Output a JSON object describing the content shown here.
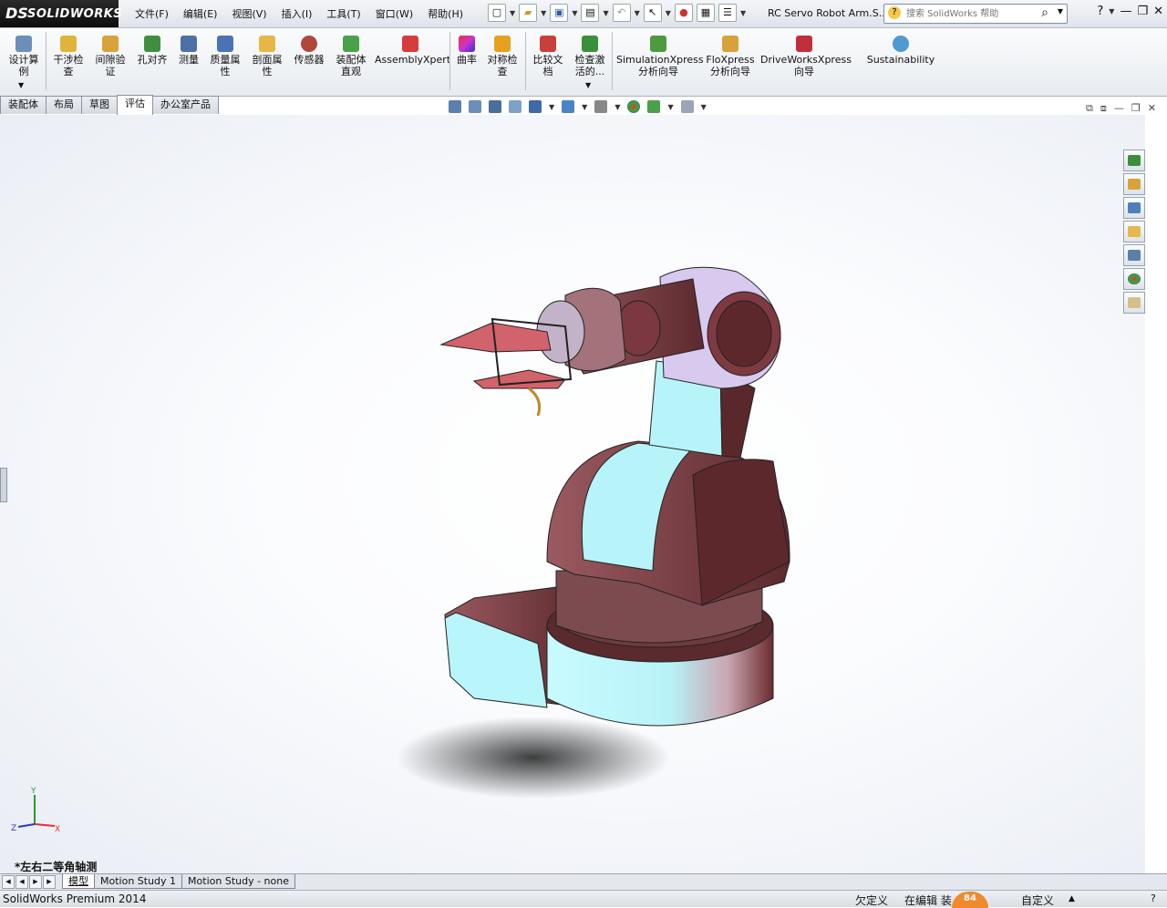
{
  "app": {
    "logo_mark": "DS",
    "logo_text": "SOLIDWORKS",
    "doc_title": "RC Servo Robot Arm.S...",
    "search_placeholder": "搜索 SolidWorks 帮助",
    "help_label": "?"
  },
  "menus": [
    "文件(F)",
    "编辑(E)",
    "视图(V)",
    "插入(I)",
    "工具(T)",
    "窗口(W)",
    "帮助(H)"
  ],
  "ribbon": {
    "tools": [
      {
        "label": "设计算\n例",
        "icon": "design-study-icon",
        "color": "#6b8fb8"
      },
      {
        "label": "干涉检\n查",
        "icon": "interference-check-icon",
        "color": "#e0b43a"
      },
      {
        "label": "间隙验\n证",
        "icon": "clearance-verify-icon",
        "color": "#d9a23a"
      },
      {
        "label": "孔对齐",
        "icon": "hole-alignment-icon",
        "color": "#3f8f3f"
      },
      {
        "label": "测量",
        "icon": "measure-icon",
        "color": "#4f6fa8"
      },
      {
        "label": "质量属\n性",
        "icon": "mass-properties-icon",
        "color": "#4a73b5"
      },
      {
        "label": "剖面属\n性",
        "icon": "section-properties-icon",
        "color": "#e8b646"
      },
      {
        "label": "传感器",
        "icon": "sensor-icon",
        "color": "#b0463c"
      },
      {
        "label": "装配体\n直观",
        "icon": "assembly-visualization-icon",
        "color": "#4aa14a"
      },
      {
        "label": "AssemblyXpert",
        "icon": "assemblyxpert-icon",
        "color": "#d63c3c"
      },
      {
        "label": "曲率",
        "icon": "curvature-icon",
        "color": "#c53ac5"
      },
      {
        "label": "对称检\n查",
        "icon": "symmetry-check-icon",
        "color": "#e6a21f"
      },
      {
        "label": "比较文\n档",
        "icon": "compare-documents-icon",
        "color": "#c9403a"
      },
      {
        "label": "检查激\n活的...",
        "icon": "check-active-icon",
        "color": "#3b8f3b"
      },
      {
        "label": "SimulationXpress\n分析向导",
        "icon": "simulationxpress-icon",
        "color": "#4f9a3f"
      },
      {
        "label": "FloXpress\n分析向导",
        "icon": "floxpress-icon",
        "color": "#d7a23a"
      },
      {
        "label": "DriveWorksXpress\n向导",
        "icon": "driveworksxpress-icon",
        "color": "#c02f3a"
      },
      {
        "label": "Sustainability",
        "icon": "sustainability-icon",
        "color": "#4f9ad0"
      }
    ]
  },
  "tabs": [
    "装配体",
    "布局",
    "草图",
    "评估",
    "办公室产品"
  ],
  "active_tab": "评估",
  "viewport": {
    "view_label": "*左右二等角轴测",
    "axis_labels": [
      "Y",
      "Z",
      "X"
    ]
  },
  "bottom_tabs": [
    "模型",
    "Motion Study 1",
    "Motion Study - none"
  ],
  "status": {
    "product": "SolidWorks Premium 2014",
    "definition": "欠定义",
    "editing": "在编辑 装",
    "units": "自定义",
    "badge": "84"
  },
  "colors": {
    "accent_orange": "#f08a2c",
    "model_cyan": "#a9f6fb",
    "model_maroon": "#6b2b2f"
  }
}
